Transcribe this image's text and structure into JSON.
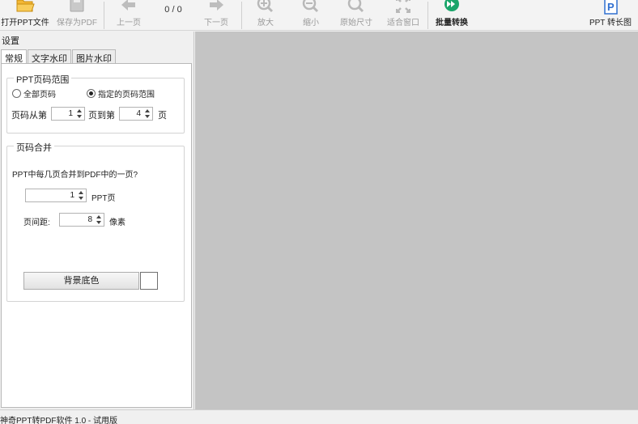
{
  "toolbar": {
    "open": "打开PPT文件",
    "save": "保存为PDF",
    "prev": "上一页",
    "page_indicator": "0 / 0",
    "next": "下一页",
    "zoom_in": "放大",
    "zoom_out": "缩小",
    "original_size": "原始尺寸",
    "fit_window": "适合窗口",
    "batch": "批量转换",
    "ppt_to_long": "PPT 转长图"
  },
  "panel": {
    "title": "设置",
    "tabs": [
      "常规",
      "文字水印",
      "图片水印"
    ],
    "page_range": {
      "legend": "PPT页码范围",
      "all_pages": "全部页码",
      "specified_pages": "指定的页码范围",
      "from_label": "页码从第",
      "from_value": "1",
      "to_label": "页到第",
      "to_value": "4",
      "unit": "页"
    },
    "merge": {
      "legend": "页码合并",
      "question": "PPT中每几页合并到PDF中的一页?",
      "count_value": "1",
      "count_unit": "PPT页",
      "spacing_label": "页间距:",
      "spacing_value": "8",
      "spacing_unit": "像素",
      "bg_button": "背景底色"
    }
  },
  "status": {
    "text": "神奇PPT转PDF软件 1.0 - 试用版"
  },
  "colors": {
    "accent_green": "#1aa56a",
    "folder_yellow": "#f2b735",
    "preview_bg": "#c4c4c4",
    "bg_swatch": "#ffffff"
  }
}
